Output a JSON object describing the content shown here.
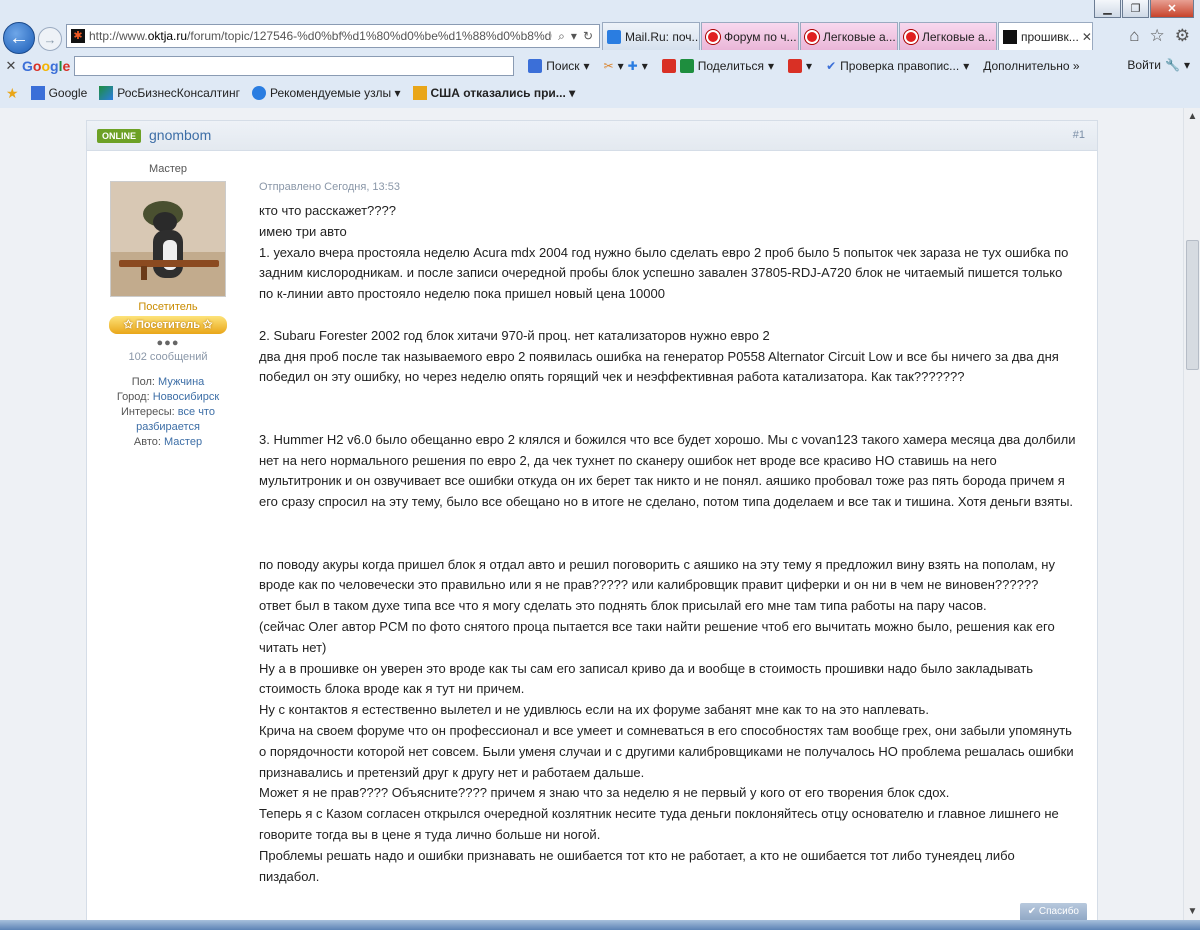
{
  "browser": {
    "address": {
      "prefix": "http://www.",
      "domain": "oktja.ru",
      "path": "/forum/topic/127546-%d0%bf%d1%80%d0%be%d1%88%d0%b8%d0%I"
    },
    "tabs": [
      {
        "label": "Mail.Ru: поч...",
        "icon": "mail-icon"
      },
      {
        "label": "Форум по ч...",
        "icon": "stop-icon"
      },
      {
        "label": "Легковые а...",
        "icon": "stop-icon"
      },
      {
        "label": "Легковые а...",
        "icon": "stop-icon"
      },
      {
        "label": "прошивк...",
        "icon": "site-icon"
      }
    ],
    "google_bar": {
      "logo": "Google",
      "search_label": "Поиск",
      "share_label": "Поделиться",
      "spellcheck_label": "Проверка правопис...",
      "more_label": "Дополнительно »",
      "signin_label": "Войти"
    },
    "favorites": [
      {
        "label": "Google"
      },
      {
        "label": "РосБизнесКонсалтинг"
      },
      {
        "label": "Рекомендуемые узлы ▾"
      },
      {
        "label": "США отказались при... ▾"
      }
    ]
  },
  "post": {
    "online_label": "ONLINE",
    "username": "gnombom",
    "number": "#1",
    "date": "Отправлено Сегодня, 13:53",
    "author": {
      "title": "Мастер",
      "rank_name": "Посетитель",
      "rank_badge": "Посетитель",
      "pips": "●●●",
      "post_count": "102 сообщений",
      "gender_label": "Пол:",
      "gender": "Мужчина",
      "city_label": "Город:",
      "city": "Новосибирск",
      "interests_label": "Интересы:",
      "interests": "все что разбирается",
      "car_label": "Авто:",
      "car": "Мастер"
    },
    "lines": [
      "кто что расскажет????",
      "имею три авто",
      "1. уехало вчера простояла неделю Acura mdx 2004 год нужно было сделать евро 2 проб было 5 попыток чек зараза не тух ошибка по",
      "задним кислородникам. и после записи очередной пробы блок успешно завален 37805-RDJ-A720 блок не читаемый пишется только",
      "по к-линии авто простояло неделю пока пришел новый цена 10000",
      "",
      "2. Subaru Forester 2002 год блок хитачи 970-й проц. нет катализаторов нужно евро 2",
      "два дня проб после так называемого евро 2 появилась ошибка на генератор P0558 Alternator Circuit Low и все бы ничего за два дня",
      "победил он эту ошибку, но через неделю опять горящий чек и неэффективная работа катализатора. Как так???????",
      "",
      "",
      "3. Hummer H2 v6.0 было обещанно евро 2 клялся и божился что все будет хорошо. Мы с vovan123 такого хамера месяца два долбили",
      "нет на него нормального решения по евро 2, да чек тухнет по сканеру ошибок нет вроде все красиво НО ставишь на него",
      "мультитроник и он озвучивает все ошибки откуда он их берет так никто и не понял. аяшико пробовал тоже раз пять борода причем я",
      "его сразу спросил на эту тему, было все обещано но в итоге не сделано, потом типа доделаем и все так и тишина. Хотя деньги взяты.",
      "",
      "",
      "по поводу акуры когда пришел блок я отдал авто и решил поговорить с аяшико на эту тему я предложил вину взять на пополам, ну",
      "вроде как по человечески это правильно или я не прав????? или калибровщик правит циферки и он ни в чем не виновен??????",
      "ответ был в таком духе типа все что я могу сделать это поднять блок присылай его мне там типа работы на пару часов.",
      "(сейчас Олег автор PCM по фото снятого проца пытается все таки найти решение чтоб его вычитать можно было, решения как его",
      "читать нет)",
      "Ну а в прошивке он уверен это вроде как ты сам его записал криво да и вообще в стоимость прошивки надо было закладывать",
      "стоимость блока вроде как я тут ни причем.",
      "Ну с контактов я естественно вылетел и не удивлюсь если на их форуме забанят мне как то на это наплевать.",
      "Крича на своем форуме что он профессионал и все умеет и сомневаться в его способностях там вообще грех, они забыли упомянуть",
      "о порядочности которой нет совсем. Были уменя случаи и с другими калибровщиками не получалось НО проблема решалась ошибки",
      "признавались и претензий друг к другу нет и работаем дальше.",
      "Может я не прав???? Объясните???? причем я знаю что за неделю я не первый у кого от его творения блок сдох.",
      "Теперь я с Казом согласен открылся очередной козлятник несите туда деньги поклоняйтесь отцу основателю и главное лишнего не",
      "говорите тогда вы в цене я туда лично больше ни ногой.",
      "Проблемы решать надо и ошибки признавать не ошибается тот кто не работает, а кто не ошибается тот либо тунеядец либо",
      "пиздабол."
    ],
    "thanks_label": "✔ Спасибо"
  }
}
